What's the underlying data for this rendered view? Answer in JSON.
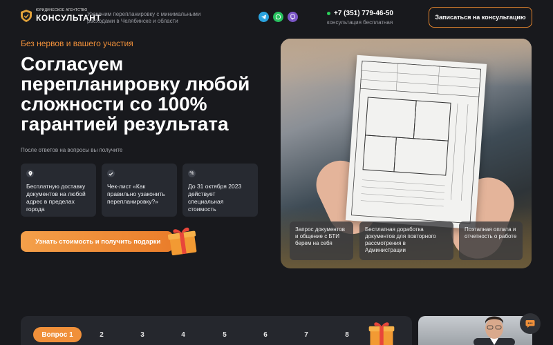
{
  "header": {
    "logo_small": "ЮРИДИЧЕСКОЕ АГЕНТСТВО",
    "logo_big": "КОНСУЛЬТАНТ",
    "tagline": "Узаконим перепланировку с минимальными расходами в Челябинске и области",
    "socials": [
      "telegram-icon",
      "whatsapp-icon",
      "viber-icon"
    ],
    "phone": "+7 (351) 779-46-50",
    "phone_note": "консультация бесплатная",
    "consult_button": "Записаться на консультацию"
  },
  "hero": {
    "eyebrow": "Без нервов и вашего участия",
    "title": "Согласуем перепланировку любой сложности со 100% гарантией результата",
    "subtitle": "После ответов на вопросы вы получите",
    "cards": [
      {
        "icon": "location-pin-icon",
        "text": "Бесплатную доставку документов на любой адрес в пределах города"
      },
      {
        "icon": "check-icon",
        "text": "Чек-лист «Как правильно узаконить перепланировку?»"
      },
      {
        "icon": "percent-icon",
        "text": "До 31 октября 2023 действует специальная стоимость"
      }
    ],
    "cta_button": "Узнать стоимость и получить подарки"
  },
  "image_info": [
    "Запрос документов и общение с БТИ берем на себя",
    "Бесплатная доработка документов для повторного рассмотрения в Администрации",
    "Поэтапная оплата и отчетность о работе"
  ],
  "quiz": {
    "tabs": [
      "Вопрос 1",
      "2",
      "3",
      "4",
      "5",
      "6",
      "7",
      "8"
    ]
  },
  "colors": {
    "background": "#18191d",
    "accent": "#f0903a",
    "card": "#272a31"
  }
}
